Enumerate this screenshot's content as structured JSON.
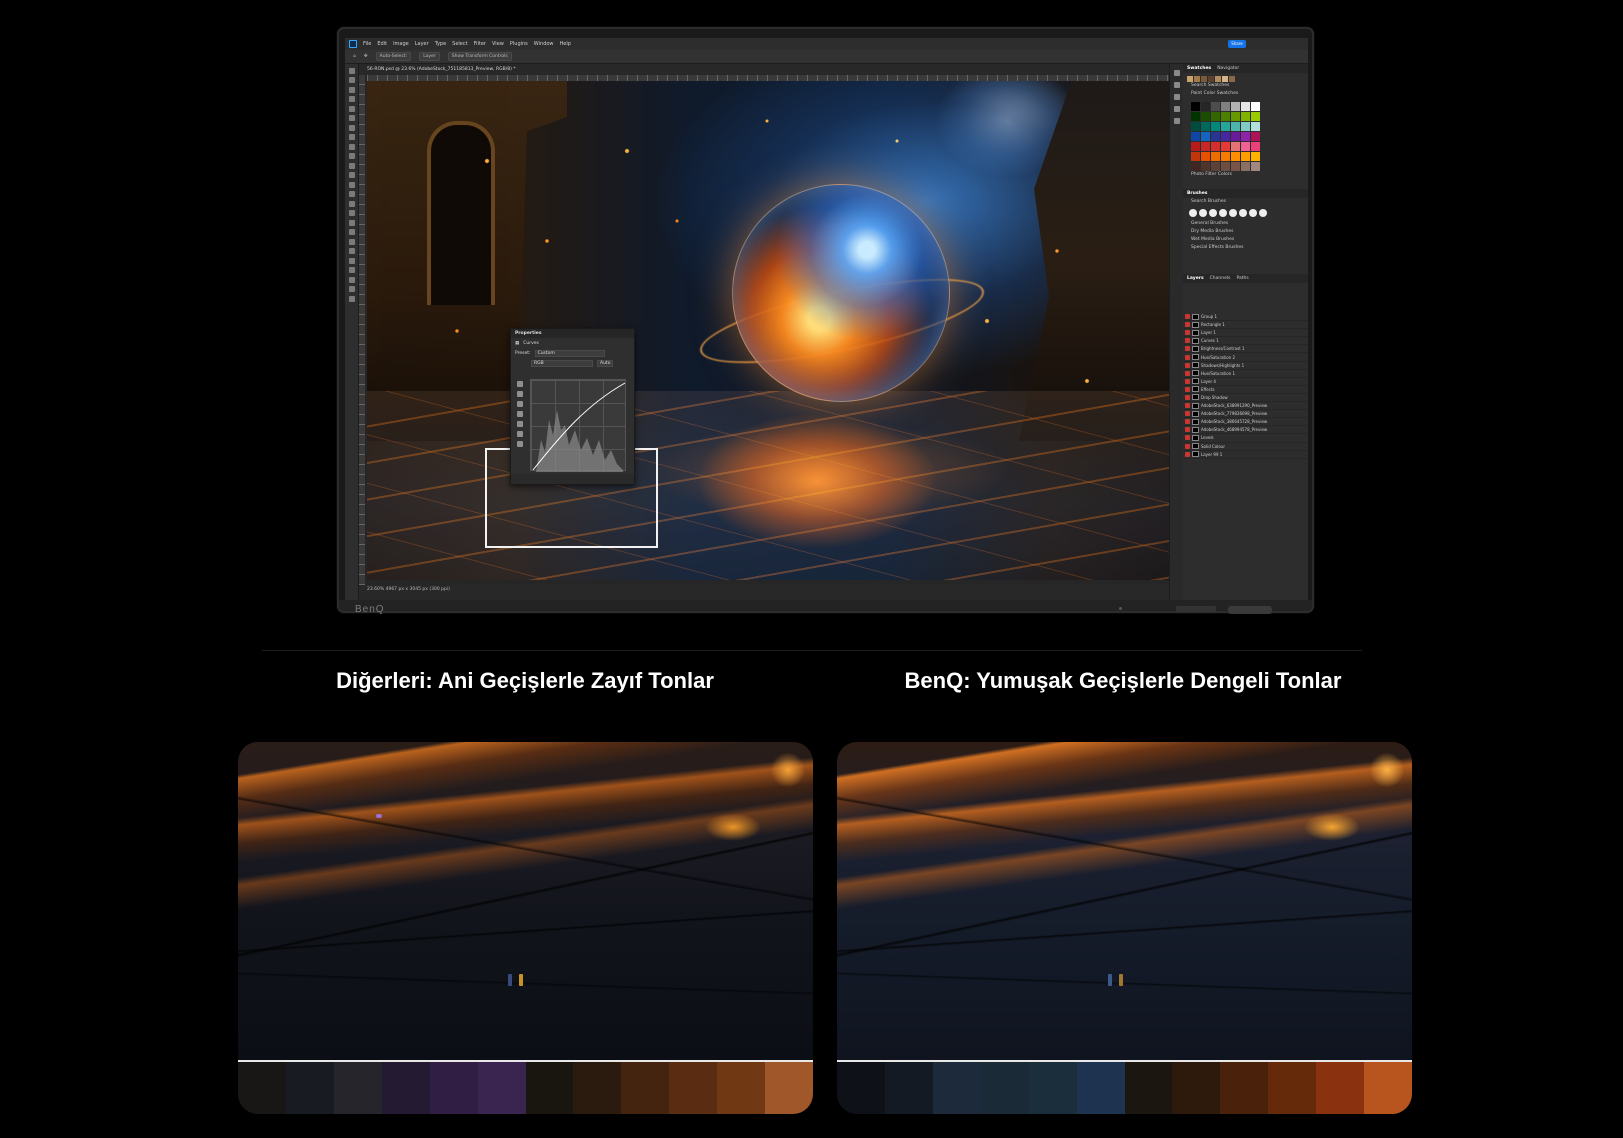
{
  "monitor": {
    "brand": "BenQ"
  },
  "photoshop": {
    "menu": [
      "File",
      "Edit",
      "Image",
      "Layer",
      "Type",
      "Select",
      "Filter",
      "View",
      "Plugins",
      "Window",
      "Help"
    ],
    "share_label": "Share",
    "options": [
      "Auto-Select:",
      "Layer",
      "Show Transform Controls"
    ],
    "document_tab": "56-RON.psd @ 23.6% (AdobeStock_751185813_Preview, RGB/8) *",
    "status": "23.60%     4967 px x 3045 px (300 ppi)",
    "properties_panel": {
      "title": "Properties",
      "adjustment": "Curves",
      "preset_label": "Preset:",
      "preset_value": "Custom",
      "channel": "RGB",
      "auto_label": "Auto"
    },
    "right_panels": {
      "swatches_tabs": [
        "Swatches",
        "Navigator"
      ],
      "swatch_search": "Search Swatches",
      "swatch_groups": [
        "Paint Color Swatches",
        "Photo Filter Colors"
      ],
      "brushes_tab": "Brushes",
      "brush_search": "Search Brushes",
      "brush_groups": [
        "General Brushes",
        "Dry Media Brushes",
        "Wet Media Brushes",
        "Special Effects Brushes"
      ],
      "layers_tabs": [
        "Layers",
        "Channels",
        "Paths"
      ],
      "layer_names": [
        "Group 1",
        "Rectangle 1",
        "Layer 1",
        "Curves 1",
        "Brightness/Contrast 1",
        "Hue/Saturation 2",
        "Shadows/Highlights 1",
        "Hue/Saturation 1",
        "Layer 4",
        "Effects",
        "Drop Shadow",
        "AdobeStock_638991290_Preview",
        "AdobeStock_779836098_Preview",
        "AdobeStock_386645728_Preview",
        "AdobeStock_468994578_Preview",
        "Levels",
        "Solid Colour",
        "Layer 99 1"
      ]
    },
    "swatch_colors": [
      "#000000",
      "#262626",
      "#4d4d4d",
      "#808080",
      "#b3b3b3",
      "#e6e6e6",
      "#ffffff",
      "#003300",
      "#1a4d00",
      "#336600",
      "#4d8000",
      "#669900",
      "#80b300",
      "#99cc00",
      "#004d40",
      "#00695c",
      "#00897b",
      "#26a69a",
      "#4db6ac",
      "#80cbc4",
      "#b2dfdb",
      "#0d47a1",
      "#1565c0",
      "#283593",
      "#4527a0",
      "#6a1b9a",
      "#8e24aa",
      "#ad1457",
      "#b71c1c",
      "#c62828",
      "#d32f2f",
      "#e53935",
      "#e57373",
      "#f06292",
      "#ec407a",
      "#bf360c",
      "#e65100",
      "#ef6c00",
      "#f57c00",
      "#ff8f00",
      "#ffa000",
      "#ffb300",
      "#3e2723",
      "#4e342e",
      "#5d4037",
      "#6d4c41",
      "#795548",
      "#8d6e63",
      "#a1887f"
    ]
  },
  "captions": {
    "left": "Diğerleri: Ani Geçişlerle Zayıf Tonlar",
    "right": "BenQ: Yumuşak Geçişlerle Dengeli Tonlar"
  },
  "comparison": {
    "left_strip": [
      "#191716",
      "#191b22",
      "#26252c",
      "#241b32",
      "#311e45",
      "#3a2450",
      "#19150f",
      "#2b1a0e",
      "#45240f",
      "#5a2c12",
      "#703913",
      "#a0582a"
    ],
    "right_strip": [
      "#0e1117",
      "#141a24",
      "#1c2a3c",
      "#1a2a36",
      "#1b2e3c",
      "#1e3350",
      "#1b1710",
      "#2e1a0c",
      "#4a220b",
      "#652a0a",
      "#8a3210",
      "#b8541e"
    ]
  }
}
